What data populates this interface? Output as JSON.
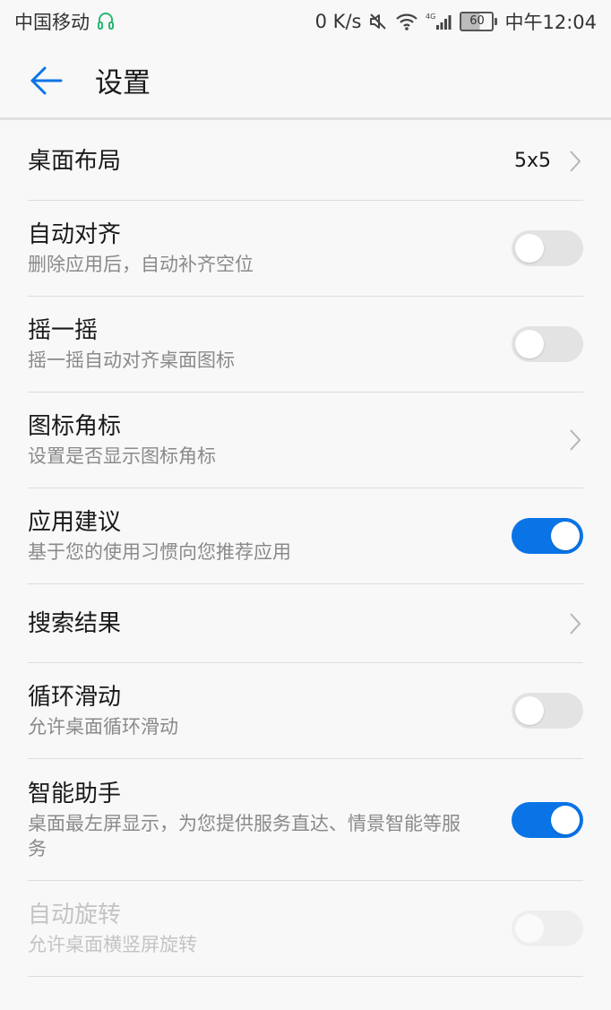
{
  "status_bar": {
    "carrier": "中国移动",
    "speed": "0 K/s",
    "network": "4G",
    "battery": "60",
    "time": "中午12:04"
  },
  "header": {
    "title": "设置"
  },
  "colors": {
    "accent": "#0a74e6",
    "toggle_off": "#e3e3e3",
    "divider": "#dcdcdc"
  },
  "settings": [
    {
      "title": "桌面布局",
      "value": "5x5",
      "control": "chevron"
    },
    {
      "title": "自动对齐",
      "subtitle": "删除应用后，自动补齐空位",
      "control": "toggle",
      "on": false
    },
    {
      "title": "摇一摇",
      "subtitle": "摇一摇自动对齐桌面图标",
      "control": "toggle",
      "on": false
    },
    {
      "title": "图标角标",
      "subtitle": "设置是否显示图标角标",
      "control": "chevron"
    },
    {
      "title": "应用建议",
      "subtitle": "基于您的使用习惯向您推荐应用",
      "control": "toggle",
      "on": true
    },
    {
      "title": "搜索结果",
      "control": "chevron"
    },
    {
      "title": "循环滑动",
      "subtitle": "允许桌面循环滑动",
      "control": "toggle",
      "on": false
    },
    {
      "title": "智能助手",
      "subtitle": "桌面最左屏显示，为您提供服务直达、情景智能等服务",
      "control": "toggle",
      "on": true
    },
    {
      "title": "自动旋转",
      "subtitle": "允许桌面横竖屏旋转",
      "control": "toggle",
      "on": false,
      "disabled": true
    }
  ]
}
